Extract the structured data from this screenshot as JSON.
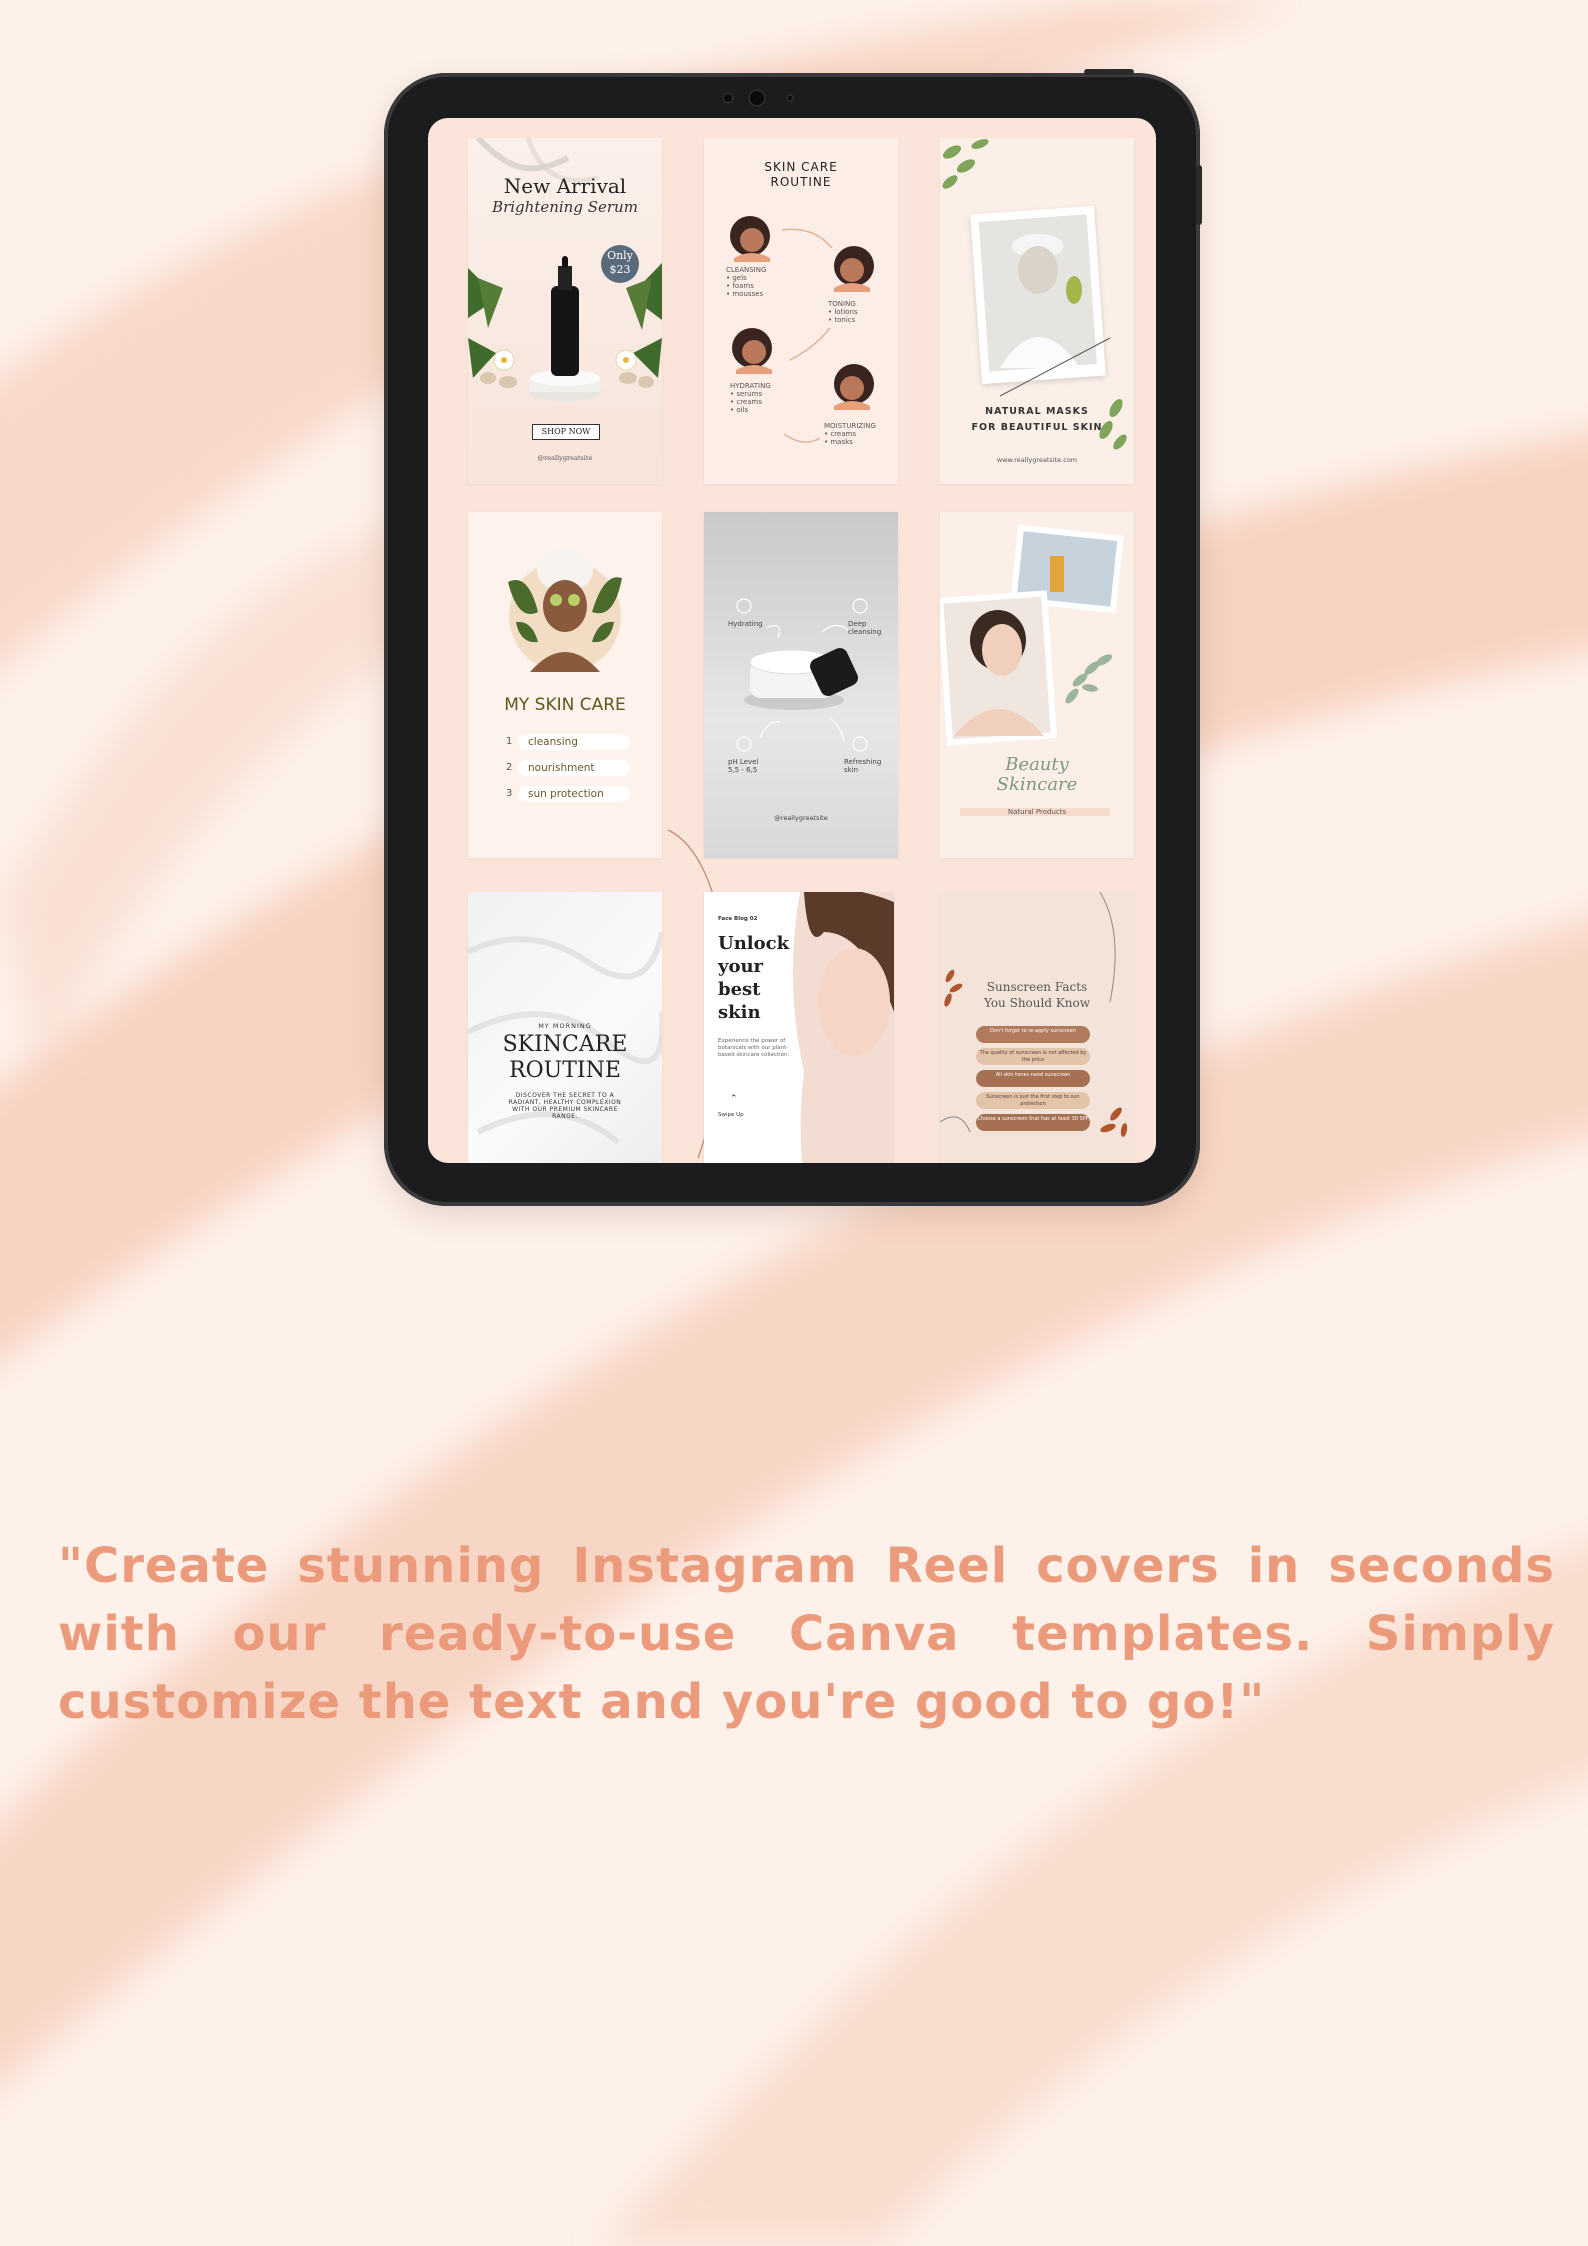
{
  "tablet": {
    "cards": {
      "new_arrival": {
        "title": "New Arrival",
        "subtitle": "Brightening Serum",
        "price_top": "Only",
        "price": "$23",
        "button": "SHOP NOW",
        "handle": "@reallygreatsite"
      },
      "routine": {
        "title_line1": "SKIN CARE",
        "title_line2": "ROUTINE",
        "steps": [
          {
            "name": "CLEANSING",
            "items": [
              "• gels",
              "• foams",
              "• mousses"
            ]
          },
          {
            "name": "TONING",
            "items": [
              "• lotions",
              "• tonics"
            ]
          },
          {
            "name": "HYDRATING",
            "items": [
              "• serums",
              "• creams",
              "• oils"
            ]
          },
          {
            "name": "MOISTURIZING",
            "items": [
              "• creams",
              "• masks"
            ]
          }
        ]
      },
      "masks": {
        "line1": "NATURAL MASKS",
        "line2": "FOR BEAUTIFUL SKIN",
        "site": "www.reallygreatsite.com"
      },
      "my_skin_care": {
        "title": "MY SKIN CARE",
        "items": [
          {
            "num": "1",
            "label": "cleansing"
          },
          {
            "num": "2",
            "label": "nourishment"
          },
          {
            "num": "3",
            "label": "sun protection"
          }
        ]
      },
      "cream": {
        "labels": [
          "Hydrating",
          "Deep cleansing",
          "pH Level 5,5 - 6,5",
          "Refreshing skin"
        ],
        "handle": "@reallygreatsite"
      },
      "beauty": {
        "title_line1": "Beauty",
        "title_line2": "Skincare",
        "sub": "Natural Products"
      },
      "morning": {
        "kicker": "MY MORNING",
        "title_line1": "SKINCARE",
        "title_line2": "ROUTINE",
        "body": "DISCOVER THE SECRET TO A RADIANT, HEALTHY COMPLEXION WITH OUR PREMIUM SKINCARE RANGE."
      },
      "unlock": {
        "kicker": "Face Blog 02",
        "title": [
          "Unlock",
          "your",
          "best",
          "skin"
        ],
        "body": "Experience the power of botanicals with our plant-based skincare collection.",
        "swipe": "Swipe Up"
      },
      "sunscreen": {
        "title_line1": "Sunscreen Facts",
        "title_line2": "You Should Know",
        "facts": [
          "Don't forget to re-apply sunscreen",
          "The quality of sunscreen is not affected by the price",
          "All skin tones need sunscreen",
          "Sunscreen is just the first step to sun protection",
          "Choose a sunscreen that has at least 30 SPF"
        ]
      }
    }
  },
  "quote": "\"Create stunning Instagram Reel covers in seconds with our ready-to-use Canva templates. Simply customize the text and you're good to go!\"",
  "colors": {
    "background": "#fdf1ea",
    "accent": "#eb9b7c",
    "tablet": "#1c1c1e",
    "screen": "#fbe5db"
  }
}
